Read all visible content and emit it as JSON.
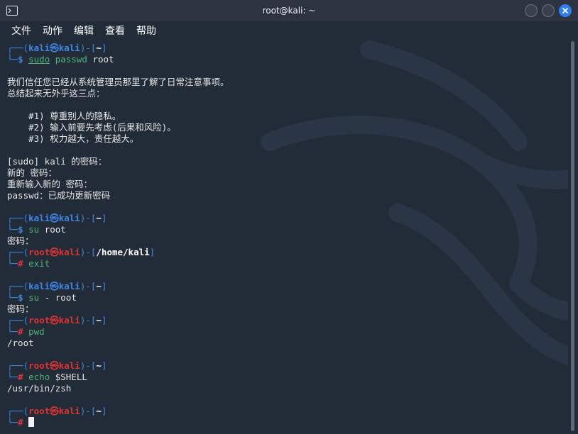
{
  "window": {
    "title": "root@kali: ~",
    "accent": "#2f7ff0"
  },
  "menu": [
    "文件",
    "动作",
    "编辑",
    "查看",
    "帮助"
  ],
  "icons": {
    "terminal": "terminal-icon",
    "minimize": "minimize-icon",
    "maximize": "maximize-icon",
    "close": "close-icon"
  },
  "colors": {
    "prompt_user": "#3f86e6",
    "prompt_root": "#e03434",
    "command": "#4fb37a",
    "background": "#222b38"
  },
  "terminal": {
    "lines": [
      [
        {
          "t": "┌──(",
          "c": "c-blue"
        },
        {
          "t": "kali㉿kali",
          "c": "c-user-blue"
        },
        {
          "t": ")-[",
          "c": "c-blue"
        },
        {
          "t": "~",
          "c": "c-white-b"
        },
        {
          "t": "]",
          "c": "c-blue"
        }
      ],
      [
        {
          "t": "└─",
          "c": "c-blue"
        },
        {
          "t": "$ ",
          "c": "c-user-blue"
        },
        {
          "t": "sudo",
          "c": "c-green u"
        },
        {
          "t": " passwd ",
          "c": "c-green"
        },
        {
          "t": "root",
          "c": "c-text"
        }
      ],
      [],
      [
        {
          "t": "我们信任您已经从系统管理员那里了解了日常注意事项。",
          "c": "c-text"
        }
      ],
      [
        {
          "t": "总结起来无外乎这三点：",
          "c": "c-text"
        }
      ],
      [],
      [
        {
          "t": "    #1) 尊重别人的隐私。",
          "c": "c-text"
        }
      ],
      [
        {
          "t": "    #2) 输入前要先考虑(后果和风险)。",
          "c": "c-text"
        }
      ],
      [
        {
          "t": "    #3) 权力越大，责任越大。",
          "c": "c-text"
        }
      ],
      [],
      [
        {
          "t": "[sudo] kali 的密码：",
          "c": "c-text"
        }
      ],
      [
        {
          "t": "新的 密码：",
          "c": "c-text"
        }
      ],
      [
        {
          "t": "重新输入新的 密码：",
          "c": "c-text"
        }
      ],
      [
        {
          "t": "passwd：已成功更新密码",
          "c": "c-text"
        }
      ],
      [],
      [
        {
          "t": "┌──(",
          "c": "c-blue"
        },
        {
          "t": "kali㉿kali",
          "c": "c-user-blue"
        },
        {
          "t": ")-[",
          "c": "c-blue"
        },
        {
          "t": "~",
          "c": "c-white-b"
        },
        {
          "t": "]",
          "c": "c-blue"
        }
      ],
      [
        {
          "t": "└─",
          "c": "c-blue"
        },
        {
          "t": "$ ",
          "c": "c-user-blue"
        },
        {
          "t": "su ",
          "c": "c-green"
        },
        {
          "t": "root",
          "c": "c-text"
        }
      ],
      [
        {
          "t": "密码：",
          "c": "c-text"
        }
      ],
      [
        {
          "t": "┌──(",
          "c": "c-blue"
        },
        {
          "t": "root㉿kali",
          "c": "c-red"
        },
        {
          "t": ")-[",
          "c": "c-blue"
        },
        {
          "t": "/home/kali",
          "c": "c-white-b"
        },
        {
          "t": "]",
          "c": "c-blue"
        }
      ],
      [
        {
          "t": "└─",
          "c": "c-blue"
        },
        {
          "t": "# ",
          "c": "c-red"
        },
        {
          "t": "exit",
          "c": "c-green"
        }
      ],
      [],
      [
        {
          "t": "┌──(",
          "c": "c-blue"
        },
        {
          "t": "kali㉿kali",
          "c": "c-user-blue"
        },
        {
          "t": ")-[",
          "c": "c-blue"
        },
        {
          "t": "~",
          "c": "c-white-b"
        },
        {
          "t": "]",
          "c": "c-blue"
        }
      ],
      [
        {
          "t": "└─",
          "c": "c-blue"
        },
        {
          "t": "$ ",
          "c": "c-user-blue"
        },
        {
          "t": "su",
          "c": "c-green"
        },
        {
          "t": " - ",
          "c": "c-text"
        },
        {
          "t": "root",
          "c": "c-text"
        }
      ],
      [
        {
          "t": "密码：",
          "c": "c-text"
        }
      ],
      [
        {
          "t": "┌──(",
          "c": "c-blue"
        },
        {
          "t": "root㉿kali",
          "c": "c-red"
        },
        {
          "t": ")-[",
          "c": "c-blue"
        },
        {
          "t": "~",
          "c": "c-white-b"
        },
        {
          "t": "]",
          "c": "c-blue"
        }
      ],
      [
        {
          "t": "└─",
          "c": "c-blue"
        },
        {
          "t": "# ",
          "c": "c-red"
        },
        {
          "t": "pwd",
          "c": "c-green"
        }
      ],
      [
        {
          "t": "/root",
          "c": "c-text"
        }
      ],
      [],
      [
        {
          "t": "┌──(",
          "c": "c-blue"
        },
        {
          "t": "root㉿kali",
          "c": "c-red"
        },
        {
          "t": ")-[",
          "c": "c-blue"
        },
        {
          "t": "~",
          "c": "c-white-b"
        },
        {
          "t": "]",
          "c": "c-blue"
        }
      ],
      [
        {
          "t": "└─",
          "c": "c-blue"
        },
        {
          "t": "# ",
          "c": "c-red"
        },
        {
          "t": "echo",
          "c": "c-green"
        },
        {
          "t": " $SHELL",
          "c": "c-text"
        }
      ],
      [
        {
          "t": "/usr/bin/zsh",
          "c": "c-text"
        }
      ],
      [],
      [
        {
          "t": "┌──(",
          "c": "c-blue"
        },
        {
          "t": "root㉿kali",
          "c": "c-red"
        },
        {
          "t": ")-[",
          "c": "c-blue"
        },
        {
          "t": "~",
          "c": "c-white-b"
        },
        {
          "t": "]",
          "c": "c-blue"
        }
      ],
      [
        {
          "t": "└─",
          "c": "c-blue"
        },
        {
          "t": "# ",
          "c": "c-red"
        }
      ]
    ]
  }
}
